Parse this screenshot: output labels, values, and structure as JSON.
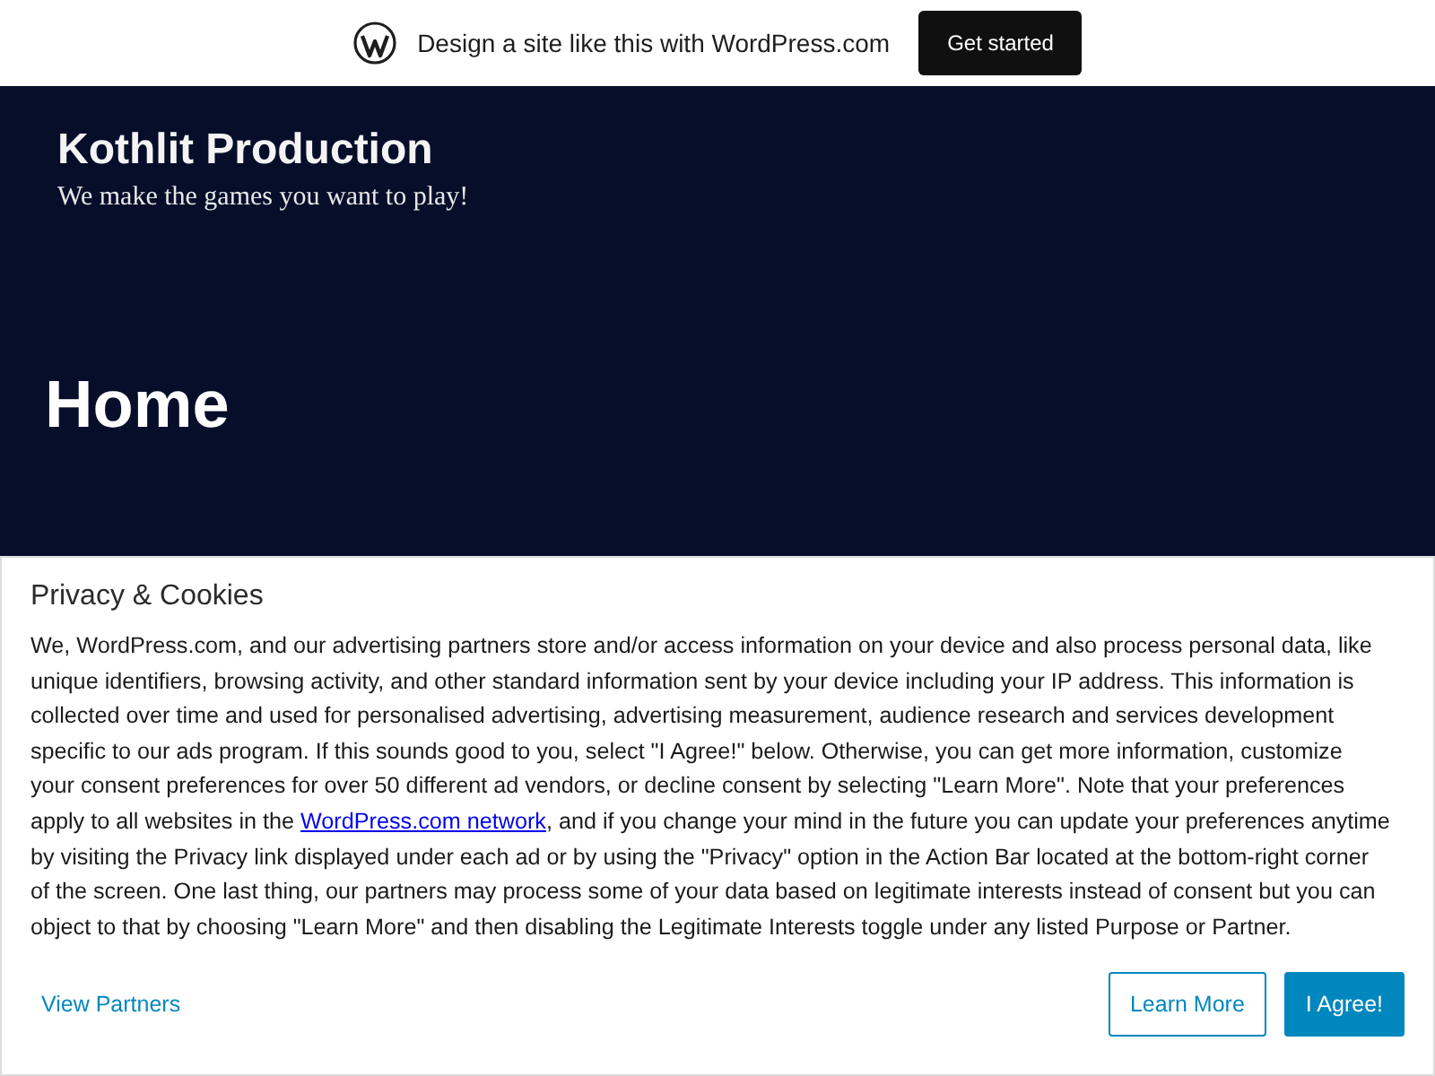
{
  "promo_bar": {
    "text": "Design a site like this with WordPress.com",
    "button": "Get started"
  },
  "site_header": {
    "title": "Kothlit Production",
    "tagline": "We make the games you want to play!"
  },
  "page": {
    "title": "Home"
  },
  "cookie_banner": {
    "title": "Privacy & Cookies",
    "text_before_link": "We, WordPress.com, and our advertising partners store and/or access information on your device and also process personal data, like unique identifiers, browsing activity, and other standard information sent by your device including your IP address. This information is collected over time and used for personalised advertising, advertising measurement, audience research and services development specific to our ads program. If this sounds good to you, select \"I Agree!\" below. Otherwise, you can get more information, customize your consent preferences for over 50 different ad vendors, or decline consent by selecting \"Learn More\". Note that your preferences apply to all websites in the ",
    "link": "WordPress.com network",
    "text_after_link": ", and if you change your mind in the future you can update your preferences anytime by visiting the Privacy link displayed under each ad or by using the \"Privacy\" option in the Action Bar located at the bottom-right corner of the screen. One last thing, our partners may process some of your data based on legitimate interests instead of consent but you can object to that by choosing \"Learn More\" and then disabling the Legitimate Interests toggle under any listed Purpose or Partner.",
    "view_partners": "View Partners",
    "learn_more": "Learn More",
    "agree": "I Agree!"
  }
}
